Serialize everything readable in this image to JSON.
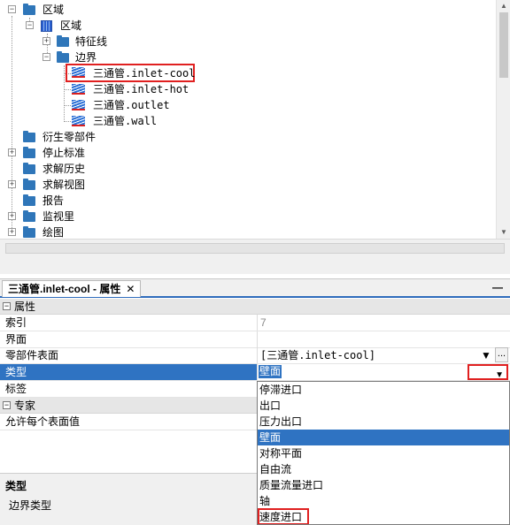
{
  "tree": {
    "items": [
      {
        "label": "区域"
      },
      {
        "label": "区域"
      },
      {
        "label": "特征线"
      },
      {
        "label": "边界"
      },
      {
        "label": "三通管.inlet-cool"
      },
      {
        "label": "三通管.inlet-hot"
      },
      {
        "label": "三通管.outlet"
      },
      {
        "label": "三通管.wall"
      },
      {
        "label": "衍生零部件"
      },
      {
        "label": "停止标准"
      },
      {
        "label": "求解历史"
      },
      {
        "label": "求解视图"
      },
      {
        "label": "报告"
      },
      {
        "label": "监视里"
      },
      {
        "label": "绘图"
      }
    ],
    "expander_collapsed": "+",
    "expander_expanded": "−"
  },
  "properties_panel": {
    "tab_label": "三通管.inlet-cool - 属性",
    "tab_close": "✕",
    "minimize": "—",
    "categories": [
      {
        "label": "属性",
        "toggle": "−"
      },
      {
        "label": "专家",
        "toggle": "−"
      }
    ],
    "rows": [
      {
        "key": "索引",
        "value": "7"
      },
      {
        "key": "界面",
        "value": ""
      },
      {
        "key": "零部件表面",
        "value": "[三通管.inlet-cool]"
      },
      {
        "key": "类型",
        "value": "壁面"
      },
      {
        "key": "标签",
        "value": ""
      },
      {
        "key": "允许每个表面值",
        "value": ""
      }
    ],
    "filter_icon": "▼",
    "more_button": "...",
    "dropdown_arrow": "▼"
  },
  "type_dropdown": {
    "options": [
      {
        "label": "停滞进口"
      },
      {
        "label": "出口"
      },
      {
        "label": "压力出口"
      },
      {
        "label": "壁面"
      },
      {
        "label": "对称平面"
      },
      {
        "label": "自由流"
      },
      {
        "label": "质量流量进口"
      },
      {
        "label": "轴"
      },
      {
        "label": "速度进口"
      }
    ],
    "highlighted": "壁面"
  },
  "description": {
    "title": "类型",
    "text": "边界类型"
  },
  "colors": {
    "accent": "#2f73c2",
    "annotation_red": "#e02020",
    "folder_blue": "#2f76b9"
  }
}
